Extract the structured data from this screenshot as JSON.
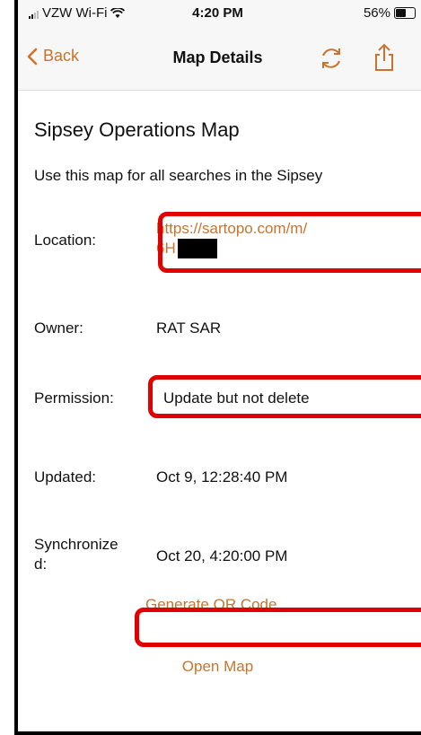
{
  "status_bar": {
    "carrier": "VZW Wi-Fi",
    "time": "4:20 PM",
    "battery": "56%",
    "battery_level": 0.56
  },
  "nav": {
    "back_label": "Back",
    "title": "Map Details",
    "icons": [
      "chevron-left-icon",
      "refresh-icon",
      "share-icon"
    ]
  },
  "map": {
    "title": "Sipsey Operations Map",
    "description": "Use this map for all searches in the Sipsey"
  },
  "details": {
    "location_label": "Location:",
    "location_value_line1": "https://sartopo.com/m/",
    "location_value_line2": "6H",
    "owner_label": "Owner:",
    "owner_value": "RAT SAR",
    "permission_label": "Permission:",
    "permission_value": "Update but not delete",
    "updated_label": "Updated:",
    "updated_value": "Oct 9, 12:28:40 PM",
    "synchronized_label_line1": "Synchronize",
    "synchronized_label_line2": "d:",
    "synchronized_value": "Oct 20, 4:20:00 PM"
  },
  "actions": {
    "generate_qr": "Generate QR Code",
    "open_map": "Open Map"
  },
  "colors": {
    "accent": "#c8742f",
    "highlight": "#e00000"
  }
}
